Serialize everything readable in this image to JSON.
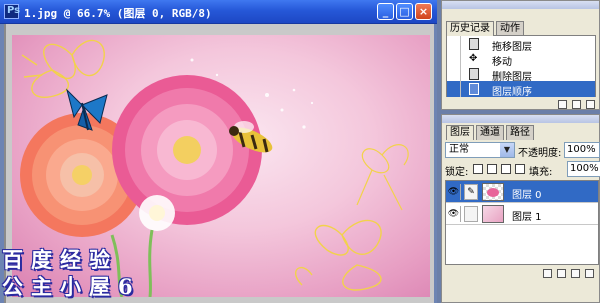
{
  "document_window": {
    "title": "1.jpg @ 66.7% (图层 0, RGB/8)",
    "minimize_glyph": "_",
    "maximize_glyph": "□",
    "close_glyph": "×"
  },
  "watermark": {
    "line1": "百度经验",
    "line2": "公主小屋6"
  },
  "history_panel": {
    "tabs": [
      {
        "label": "历史记录",
        "active": true
      },
      {
        "label": "动作",
        "active": false
      }
    ],
    "items": [
      {
        "label": "拖移图层",
        "icon": "document-icon",
        "selected": false
      },
      {
        "label": "移动",
        "icon": "move-icon",
        "selected": false
      },
      {
        "label": "删除图层",
        "icon": "document-icon",
        "selected": false
      },
      {
        "label": "图层顺序",
        "icon": "document-icon",
        "selected": true
      }
    ]
  },
  "layers_panel": {
    "tabs": [
      {
        "label": "图层",
        "active": true
      },
      {
        "label": "通道",
        "active": false
      },
      {
        "label": "路径",
        "active": false
      }
    ],
    "blend_mode": "正常",
    "opacity_label": "不透明度:",
    "opacity_value": "100%",
    "lock_label": "锁定:",
    "fill_label": "填充:",
    "fill_value": "100%",
    "layers": [
      {
        "name": "图层 0",
        "selected": true
      },
      {
        "name": "图层 1",
        "selected": false
      }
    ]
  },
  "colors": {
    "titlebar": "#2658d8",
    "selection": "#316ac5",
    "panel_bg": "#ece9d8",
    "workspace": "#6b7fa8",
    "canvas_pink": "#f4c7dc"
  }
}
